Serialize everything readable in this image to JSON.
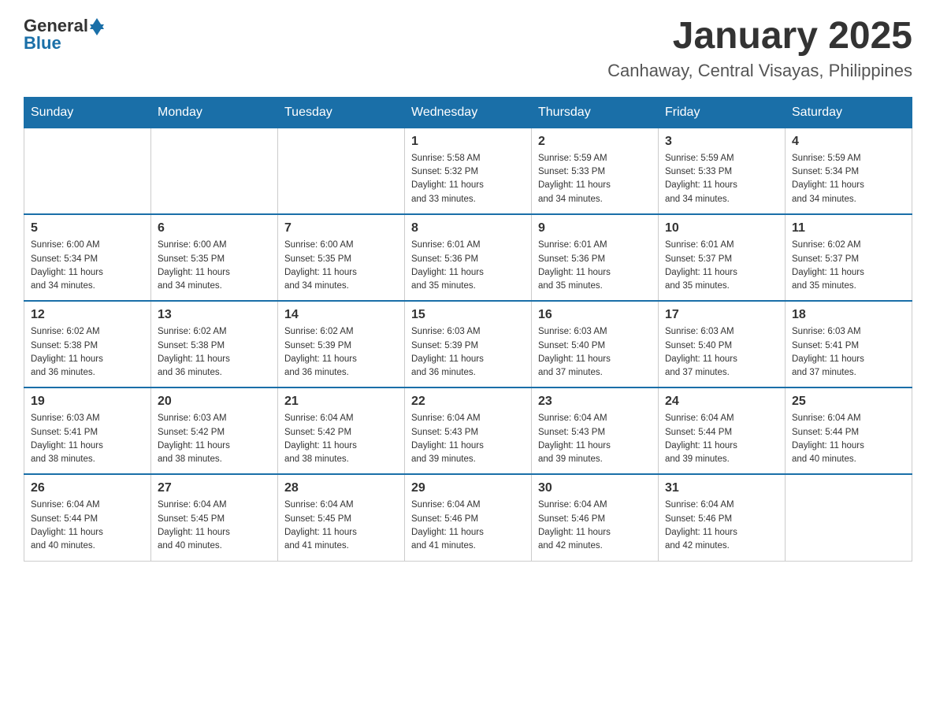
{
  "header": {
    "logo_general": "General",
    "logo_blue": "Blue",
    "title": "January 2025",
    "location": "Canhaway, Central Visayas, Philippines"
  },
  "calendar": {
    "days_of_week": [
      "Sunday",
      "Monday",
      "Tuesday",
      "Wednesday",
      "Thursday",
      "Friday",
      "Saturday"
    ],
    "weeks": [
      [
        {
          "day": "",
          "info": ""
        },
        {
          "day": "",
          "info": ""
        },
        {
          "day": "",
          "info": ""
        },
        {
          "day": "1",
          "info": "Sunrise: 5:58 AM\nSunset: 5:32 PM\nDaylight: 11 hours\nand 33 minutes."
        },
        {
          "day": "2",
          "info": "Sunrise: 5:59 AM\nSunset: 5:33 PM\nDaylight: 11 hours\nand 34 minutes."
        },
        {
          "day": "3",
          "info": "Sunrise: 5:59 AM\nSunset: 5:33 PM\nDaylight: 11 hours\nand 34 minutes."
        },
        {
          "day": "4",
          "info": "Sunrise: 5:59 AM\nSunset: 5:34 PM\nDaylight: 11 hours\nand 34 minutes."
        }
      ],
      [
        {
          "day": "5",
          "info": "Sunrise: 6:00 AM\nSunset: 5:34 PM\nDaylight: 11 hours\nand 34 minutes."
        },
        {
          "day": "6",
          "info": "Sunrise: 6:00 AM\nSunset: 5:35 PM\nDaylight: 11 hours\nand 34 minutes."
        },
        {
          "day": "7",
          "info": "Sunrise: 6:00 AM\nSunset: 5:35 PM\nDaylight: 11 hours\nand 34 minutes."
        },
        {
          "day": "8",
          "info": "Sunrise: 6:01 AM\nSunset: 5:36 PM\nDaylight: 11 hours\nand 35 minutes."
        },
        {
          "day": "9",
          "info": "Sunrise: 6:01 AM\nSunset: 5:36 PM\nDaylight: 11 hours\nand 35 minutes."
        },
        {
          "day": "10",
          "info": "Sunrise: 6:01 AM\nSunset: 5:37 PM\nDaylight: 11 hours\nand 35 minutes."
        },
        {
          "day": "11",
          "info": "Sunrise: 6:02 AM\nSunset: 5:37 PM\nDaylight: 11 hours\nand 35 minutes."
        }
      ],
      [
        {
          "day": "12",
          "info": "Sunrise: 6:02 AM\nSunset: 5:38 PM\nDaylight: 11 hours\nand 36 minutes."
        },
        {
          "day": "13",
          "info": "Sunrise: 6:02 AM\nSunset: 5:38 PM\nDaylight: 11 hours\nand 36 minutes."
        },
        {
          "day": "14",
          "info": "Sunrise: 6:02 AM\nSunset: 5:39 PM\nDaylight: 11 hours\nand 36 minutes."
        },
        {
          "day": "15",
          "info": "Sunrise: 6:03 AM\nSunset: 5:39 PM\nDaylight: 11 hours\nand 36 minutes."
        },
        {
          "day": "16",
          "info": "Sunrise: 6:03 AM\nSunset: 5:40 PM\nDaylight: 11 hours\nand 37 minutes."
        },
        {
          "day": "17",
          "info": "Sunrise: 6:03 AM\nSunset: 5:40 PM\nDaylight: 11 hours\nand 37 minutes."
        },
        {
          "day": "18",
          "info": "Sunrise: 6:03 AM\nSunset: 5:41 PM\nDaylight: 11 hours\nand 37 minutes."
        }
      ],
      [
        {
          "day": "19",
          "info": "Sunrise: 6:03 AM\nSunset: 5:41 PM\nDaylight: 11 hours\nand 38 minutes."
        },
        {
          "day": "20",
          "info": "Sunrise: 6:03 AM\nSunset: 5:42 PM\nDaylight: 11 hours\nand 38 minutes."
        },
        {
          "day": "21",
          "info": "Sunrise: 6:04 AM\nSunset: 5:42 PM\nDaylight: 11 hours\nand 38 minutes."
        },
        {
          "day": "22",
          "info": "Sunrise: 6:04 AM\nSunset: 5:43 PM\nDaylight: 11 hours\nand 39 minutes."
        },
        {
          "day": "23",
          "info": "Sunrise: 6:04 AM\nSunset: 5:43 PM\nDaylight: 11 hours\nand 39 minutes."
        },
        {
          "day": "24",
          "info": "Sunrise: 6:04 AM\nSunset: 5:44 PM\nDaylight: 11 hours\nand 39 minutes."
        },
        {
          "day": "25",
          "info": "Sunrise: 6:04 AM\nSunset: 5:44 PM\nDaylight: 11 hours\nand 40 minutes."
        }
      ],
      [
        {
          "day": "26",
          "info": "Sunrise: 6:04 AM\nSunset: 5:44 PM\nDaylight: 11 hours\nand 40 minutes."
        },
        {
          "day": "27",
          "info": "Sunrise: 6:04 AM\nSunset: 5:45 PM\nDaylight: 11 hours\nand 40 minutes."
        },
        {
          "day": "28",
          "info": "Sunrise: 6:04 AM\nSunset: 5:45 PM\nDaylight: 11 hours\nand 41 minutes."
        },
        {
          "day": "29",
          "info": "Sunrise: 6:04 AM\nSunset: 5:46 PM\nDaylight: 11 hours\nand 41 minutes."
        },
        {
          "day": "30",
          "info": "Sunrise: 6:04 AM\nSunset: 5:46 PM\nDaylight: 11 hours\nand 42 minutes."
        },
        {
          "day": "31",
          "info": "Sunrise: 6:04 AM\nSunset: 5:46 PM\nDaylight: 11 hours\nand 42 minutes."
        },
        {
          "day": "",
          "info": ""
        }
      ]
    ]
  }
}
